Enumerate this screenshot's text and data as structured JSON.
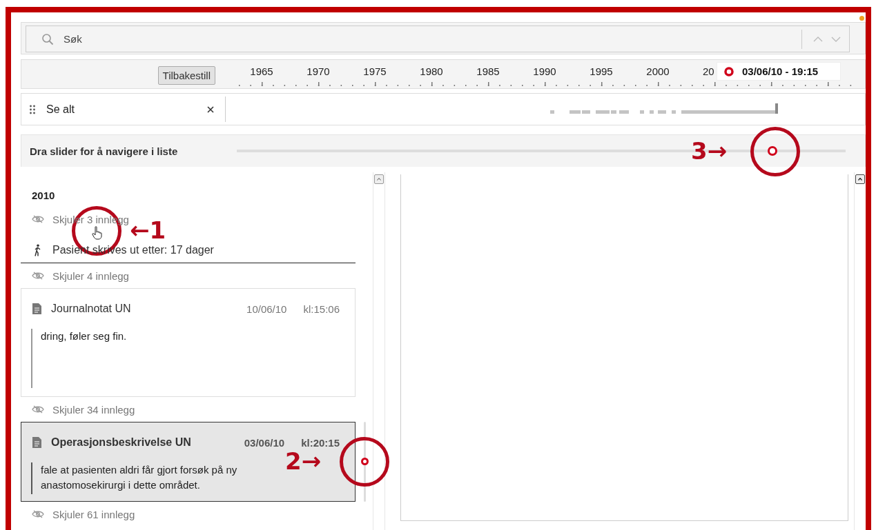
{
  "search": {
    "placeholder": "Søk"
  },
  "timeline": {
    "reset_button": "Tilbakestill",
    "years": [
      "1965",
      "1970",
      "1975",
      "1980",
      "1985",
      "1990",
      "1995",
      "2000",
      "20"
    ],
    "tooltip": "03/06/10 - 19:15"
  },
  "filter": {
    "label": "Se alt"
  },
  "slider": {
    "label": "Dra slider for å navigere i liste",
    "level": 0.88
  },
  "entries": [
    {
      "kind": "year",
      "text": "2010"
    },
    {
      "kind": "hidden",
      "text": "Skjuler 3 innlegg"
    },
    {
      "kind": "event",
      "text": "Pasient skrives ut etter: 17 dager"
    },
    {
      "kind": "hidden",
      "text": "Skjuler 4 innlegg"
    },
    {
      "kind": "note",
      "title": "Journalnotat UN",
      "date": "10/06/10",
      "time": "kl:15:06",
      "body": "dring, føler seg fin.",
      "selected": false
    },
    {
      "kind": "hidden",
      "text": "Skjuler 34 innlegg"
    },
    {
      "kind": "note",
      "title": "Operasjonsbeskrivelse UN",
      "date": "03/06/10",
      "time": "kl:20:15",
      "body": "fale at pasienten aldri får gjort forsøk på ny anastomosekirurgi i dette området.",
      "selected": true
    },
    {
      "kind": "hidden",
      "text": "Skjuler 61 innlegg"
    }
  ],
  "annotations": [
    {
      "label": "←1"
    },
    {
      "label": "2→"
    },
    {
      "label": "3→"
    }
  ]
}
